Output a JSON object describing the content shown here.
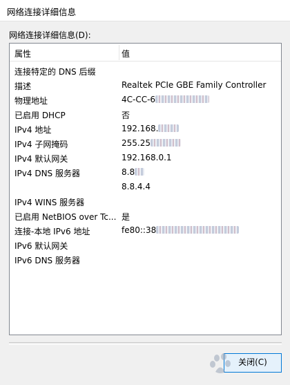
{
  "window": {
    "title": "网络连接详细信息"
  },
  "group_label": "网络连接详细信息(D):",
  "list": {
    "col_property": "属性",
    "col_value": "值",
    "rows": [
      {
        "property": "连接特定的 DNS 后缀",
        "value": ""
      },
      {
        "property": "描述",
        "value": "Realtek PCIe GBE Family Controller"
      },
      {
        "property": "物理地址",
        "value": "4C-CC-6"
      },
      {
        "property": "已启用 DHCP",
        "value": "否"
      },
      {
        "property": "IPv4 地址",
        "value": "192.168."
      },
      {
        "property": "IPv4 子网掩码",
        "value": "255.25"
      },
      {
        "property": "IPv4 默认网关",
        "value": "192.168.0.1"
      },
      {
        "property": "IPv4 DNS 服务器",
        "value": "8.8"
      },
      {
        "property": "",
        "value": "8.8.4.4"
      },
      {
        "property": "IPv4 WINS 服务器",
        "value": ""
      },
      {
        "property": "已启用 NetBIOS over Tc...",
        "value": "是"
      },
      {
        "property": "连接-本地 IPv6 地址",
        "value": "fe80::38"
      },
      {
        "property": "IPv6 默认网关",
        "value": ""
      },
      {
        "property": "IPv6 DNS 服务器",
        "value": ""
      }
    ]
  },
  "buttons": {
    "close_label": "关闭(C)"
  },
  "colors": {
    "window_bg": "#f0f0f0",
    "list_bg": "#ffffff",
    "button_border": "#0078d7",
    "button_bg": "#e5f1fb"
  },
  "watermark_icon": "baidu-watermark-icon"
}
